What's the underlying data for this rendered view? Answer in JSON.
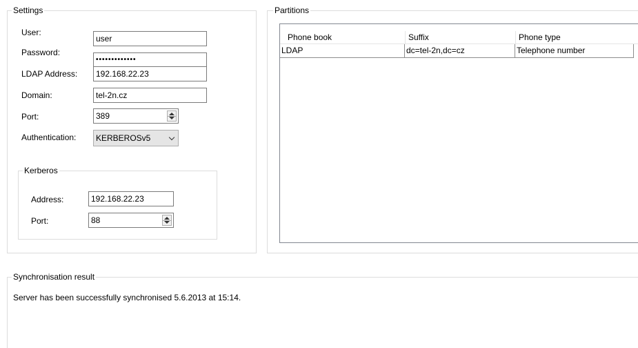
{
  "settings": {
    "title": "Settings",
    "user": {
      "label": "User:",
      "value": "user"
    },
    "password": {
      "label": "Password:",
      "value": "•••••••••••••"
    },
    "ldap_address": {
      "label": "LDAP Address:",
      "value": "192.168.22.23"
    },
    "domain": {
      "label": "Domain:",
      "value": "tel-2n.cz"
    },
    "port": {
      "label": "Port:",
      "value": "389"
    },
    "authentication": {
      "label": "Authentication:",
      "value": "KERBEROSv5"
    },
    "kerberos": {
      "title": "Kerberos",
      "address": {
        "label": "Address:",
        "value": "192.168.22.23"
      },
      "port": {
        "label": "Port:",
        "value": "88"
      }
    }
  },
  "partitions": {
    "title": "Partitions",
    "columns": [
      "Phone book",
      "Suffix",
      "Phone type"
    ],
    "rows": [
      [
        "LDAP",
        "dc=tel-2n,dc=cz",
        "Telephone number"
      ]
    ]
  },
  "sync": {
    "title": "Synchronisation result",
    "message": "Server has been successfully synchronised 5.6.2013 at 15:14."
  }
}
